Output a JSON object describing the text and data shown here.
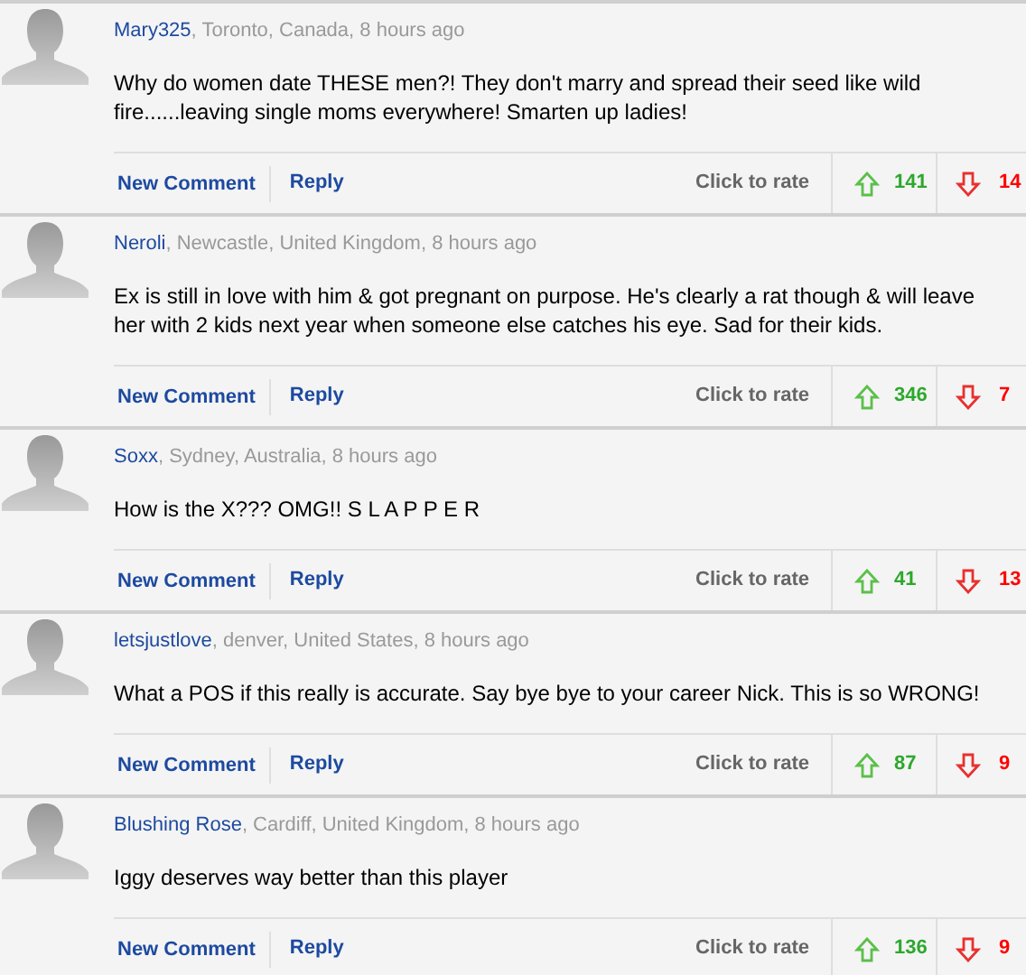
{
  "comments": [
    {
      "author": "Mary325",
      "meta": ", Toronto, Canada, 8 hours ago",
      "text": "Why do women date THESE men?! They don't marry and spread their seed like wild fire......leaving single moms everywhere! Smarten up ladies!",
      "new_comment": "New Comment",
      "reply": "Reply",
      "rate_label": "Click to rate",
      "up": "141",
      "down": "14"
    },
    {
      "author": "Neroli",
      "meta": ", Newcastle, United Kingdom, 8 hours ago",
      "text": "Ex is still in love with him & got pregnant on purpose. He's clearly a rat though & will leave her with 2 kids next year when someone else catches his eye. Sad for their kids.",
      "new_comment": "New Comment",
      "reply": "Reply",
      "rate_label": "Click to rate",
      "up": "346",
      "down": "7"
    },
    {
      "author": "Soxx",
      "meta": ", Sydney, Australia, 8 hours ago",
      "text": "How is the X??? OMG!! S L A P P E R",
      "new_comment": "New Comment",
      "reply": "Reply",
      "rate_label": "Click to rate",
      "up": "41",
      "down": "13"
    },
    {
      "author": "letsjustlove",
      "meta": ", denver, United States, 8 hours ago",
      "text": "What a POS if this really is accurate. Say bye bye to your career Nick. This is so WRONG!",
      "new_comment": "New Comment",
      "reply": "Reply",
      "rate_label": "Click to rate",
      "up": "87",
      "down": "9"
    },
    {
      "author": "Blushing Rose",
      "meta": ", Cardiff, United Kingdom, 8 hours ago",
      "text": "Iggy deserves way better than this player",
      "new_comment": "New Comment",
      "reply": "Reply",
      "rate_label": "Click to rate",
      "up": "136",
      "down": "9"
    }
  ]
}
